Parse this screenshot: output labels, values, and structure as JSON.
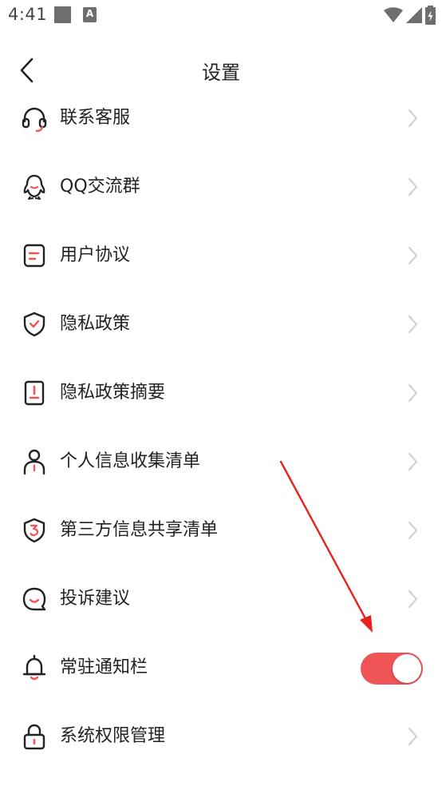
{
  "status_bar": {
    "time": "4:41",
    "notification_icons": [
      "square-notification-icon",
      "a-notification-icon"
    ],
    "right_icons": [
      "wifi-icon",
      "signal-icon",
      "battery-icon"
    ],
    "a_icon_text": "A"
  },
  "header": {
    "title": "设置",
    "back_icon": "chevron-left-icon"
  },
  "settings": {
    "items": [
      {
        "label": "联系客服",
        "icon": "headset-icon",
        "control": "chevron"
      },
      {
        "label": "QQ交流群",
        "icon": "qq-penguin-icon",
        "control": "chevron"
      },
      {
        "label": "用户协议",
        "icon": "document-icon",
        "control": "chevron"
      },
      {
        "label": "隐私政策",
        "icon": "shield-check-icon",
        "control": "chevron"
      },
      {
        "label": "隐私政策摘要",
        "icon": "document-alert-icon",
        "control": "chevron"
      },
      {
        "label": "个人信息收集清单",
        "icon": "person-icon",
        "control": "chevron"
      },
      {
        "label": "第三方信息共享清单",
        "icon": "shield-number-icon",
        "control": "chevron"
      },
      {
        "label": "投诉建议",
        "icon": "chat-bubble-icon",
        "control": "chevron"
      },
      {
        "label": "常驻通知栏",
        "icon": "bell-icon",
        "control": "toggle",
        "toggle_on": true
      },
      {
        "label": "系统权限管理",
        "icon": "lock-icon",
        "control": "chevron"
      }
    ]
  },
  "colors": {
    "accent": "#ef5457",
    "icon_stroke": "#222222",
    "chevron": "#cccccc",
    "annotation_arrow": "#e8211d"
  }
}
